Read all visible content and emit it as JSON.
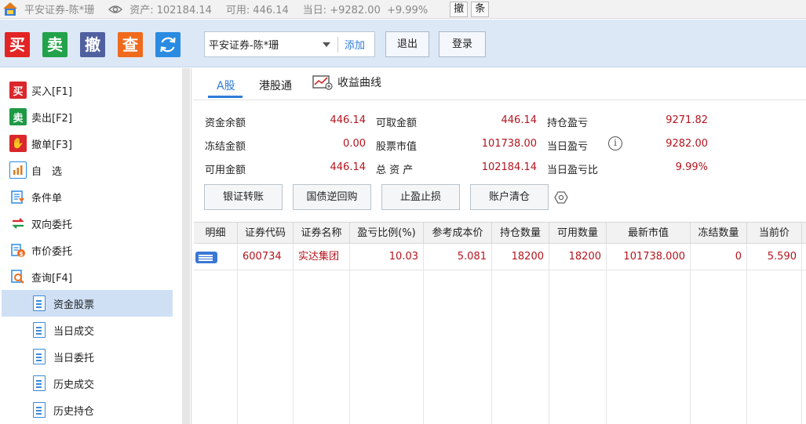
{
  "titlebar": {
    "account": "平安证券-陈*珊",
    "assets_label": "资产:",
    "assets_value": "102184.14",
    "available_label": "可用:",
    "available_value": "446.14",
    "today_label": "当日:",
    "today_value": "+9282.00",
    "today_pct": "+9.99%",
    "cancel_btn": "撤",
    "bar_btn": "条"
  },
  "toolbar": {
    "buy": "买",
    "sell": "卖",
    "cancel": "撤",
    "query": "查",
    "account_select": "平安证券-陈*珊",
    "add": "添加",
    "logout": "退出",
    "login": "登录",
    "colors": {
      "buy": "#e32424",
      "sell": "#22a24a",
      "cancel": "#4f5fa0",
      "query": "#f06a1e",
      "refresh": "#2a8be0"
    }
  },
  "sidebar": {
    "items": [
      {
        "label": "买入[F1]",
        "icon": "buy-icon",
        "glyph": "买",
        "color": "#d9272b"
      },
      {
        "label": "卖出[F2]",
        "icon": "sell-icon",
        "glyph": "卖",
        "color": "#1e9a45"
      },
      {
        "label": "撤单[F3]",
        "icon": "hand-icon",
        "glyph": "✋",
        "color": "#d9272b"
      },
      {
        "label": "自　选",
        "icon": "watchlist-icon",
        "glyph": "▮",
        "color": "#2a8be0"
      },
      {
        "label": "条件单",
        "icon": "condition-order-icon",
        "glyph": "▤",
        "color": "#2a8be0"
      },
      {
        "label": "双向委托",
        "icon": "two-way-order-icon",
        "glyph": "⇄",
        "color": "#2a8be0"
      },
      {
        "label": "市价委托",
        "icon": "market-order-icon",
        "glyph": "$",
        "color": "#e07a1a"
      },
      {
        "label": "查询[F4]",
        "icon": "query-icon",
        "glyph": "⌕",
        "color": "#2a8be0"
      }
    ],
    "subitems": [
      {
        "label": "资金股票",
        "active": true
      },
      {
        "label": "当日成交",
        "active": false
      },
      {
        "label": "当日委托",
        "active": false
      },
      {
        "label": "历史成交",
        "active": false
      },
      {
        "label": "历史持仓",
        "active": false
      }
    ]
  },
  "tabs": {
    "a_share": "A股",
    "hk_connect": "港股通",
    "profit_curve": "收益曲线"
  },
  "summary": {
    "balance_label": "资金余额",
    "balance": "446.14",
    "withdrawable_label": "可取金额",
    "withdrawable": "446.14",
    "position_pl_label": "持仓盈亏",
    "position_pl": "9271.82",
    "frozen_label": "冻结金额",
    "frozen": "0.00",
    "market_value_label": "股票市值",
    "market_value": "101738.00",
    "today_pl_label": "当日盈亏",
    "today_pl": "9282.00",
    "available_label": "可用金额",
    "available": "446.14",
    "total_assets_label": "总 资 产",
    "total_assets": "102184.14",
    "today_pl_pct_label": "当日盈亏比",
    "today_pl_pct": "9.99%"
  },
  "actions": {
    "bank_transfer": "银证转账",
    "repo": "国债逆回购",
    "stop": "止盈止损",
    "clear": "账户清仓"
  },
  "table": {
    "headers": [
      "明细",
      "证券代码",
      "证券名称",
      "盈亏比例(%)",
      "参考成本价",
      "持仓数量",
      "可用数量",
      "最新市值",
      "冻结数量",
      "当前价"
    ],
    "rows": [
      {
        "code": "600734",
        "name": "实达集团",
        "pl_pct": "10.03",
        "cost": "5.081",
        "qty": "18200",
        "avail": "18200",
        "mkt": "101738.000",
        "frozen": "0",
        "price": "5.590"
      }
    ]
  },
  "colors": {
    "accent": "#2f7bd8",
    "value_red": "#b4141e",
    "active_row": "#cfe0f5"
  }
}
